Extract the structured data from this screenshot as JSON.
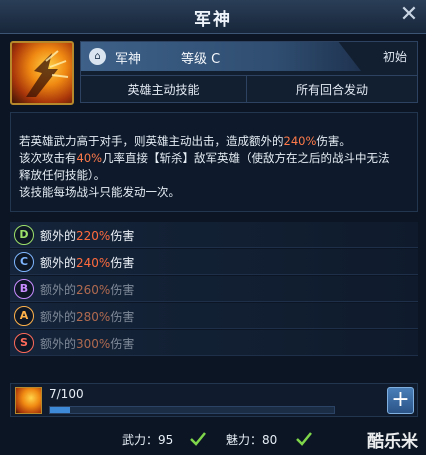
{
  "window": {
    "title": "军神"
  },
  "skill": {
    "name": "军神",
    "grade": "等级 C",
    "state": "初始",
    "type_tag": "英雄主动技能",
    "trigger_tag": "所有回合发动"
  },
  "description": {
    "line1_a": "若英雄武力高于对手，则英雄主动出击，造成额外的",
    "line1_pct": "240%",
    "line1_b": "伤害。",
    "line2_a": "该次攻击有",
    "line2_pct": "40%",
    "line2_b": "几率直接【斩杀】敌军英雄（使敌方在之后的战斗中无法",
    "line3": "释放任何技能）。",
    "line4": "该技能每场战斗只能发动一次。"
  },
  "levels": [
    {
      "grade": "D",
      "prefix": "额外的",
      "pct": "220%",
      "suffix": "伤害",
      "color": "#9de06a",
      "active": true
    },
    {
      "grade": "C",
      "prefix": "额外的",
      "pct": "240%",
      "suffix": "伤害",
      "color": "#7fb6ff",
      "active": true
    },
    {
      "grade": "B",
      "prefix": "额外的",
      "pct": "260%",
      "suffix": "伤害",
      "color": "#c98cff",
      "active": false
    },
    {
      "grade": "A",
      "prefix": "额外的",
      "pct": "280%",
      "suffix": "伤害",
      "color": "#ffb14a",
      "active": false
    },
    {
      "grade": "S",
      "prefix": "额外的",
      "pct": "300%",
      "suffix": "伤害",
      "color": "#ff6a5a",
      "active": false
    }
  ],
  "experience": {
    "text": "7/100",
    "progress": 0.07
  },
  "stats": {
    "force": "武力：95",
    "charm": "魅力：80"
  },
  "watermark": "酷乐米",
  "icons": {
    "close": "close-icon",
    "plus": "plus-icon",
    "lock": "lock-icon",
    "check": "check-icon"
  },
  "colors": {
    "accent": "#3e8ad9",
    "highlight": "#ff7a4a",
    "frame": "#b8892a"
  }
}
